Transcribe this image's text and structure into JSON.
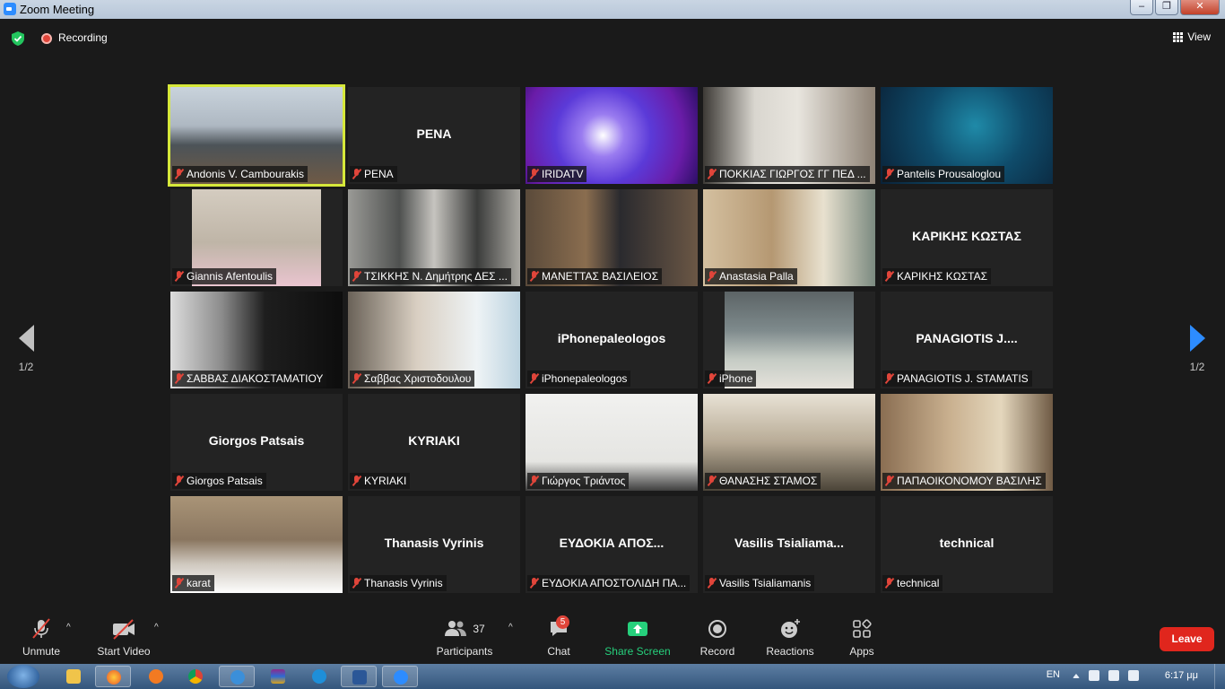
{
  "window": {
    "title": "Zoom Meeting",
    "min": "–",
    "max": "❐",
    "close": "✕"
  },
  "topbar": {
    "recording": "Recording",
    "view": "View"
  },
  "pager": {
    "left": "1/2",
    "right": "1/2"
  },
  "tiles": [
    {
      "label": "Andonis V. Cambourakis",
      "big": "",
      "video": "council-room",
      "active": true
    },
    {
      "label": "PENA",
      "big": "PENA",
      "video": ""
    },
    {
      "label": "IRIDATV",
      "big": "",
      "video": "iridatv-logo"
    },
    {
      "label": "ΠΟΚΚΙΑΣ ΓΙΩΡΓΟΣ ΓΓ ΠΕΔ ...",
      "big": "",
      "video": "office-man"
    },
    {
      "label": "Pantelis Prousaloglou",
      "big": "",
      "video": "knx-logo"
    },
    {
      "label": "Giannis Afentoulis",
      "big": "",
      "video": "man-white-hair"
    },
    {
      "label": "ΤΣΙΚΚΗΣ Ν. Δημήτρης ΔΕΣ ...",
      "big": "",
      "video": "bus-interior"
    },
    {
      "label": "ΜΑΝΕΤΤΑΣ ΒΑΣΙΛΕΙΟΣ",
      "big": "",
      "video": "bookshelf-man"
    },
    {
      "label": "Anastasia Palla",
      "big": "",
      "video": "room-painting"
    },
    {
      "label": "ΚΑΡΙΚΗΣ ΚΩΣΤΑΣ",
      "big": "ΚΑΡΙΚΗΣ ΚΩΣΤΑΣ",
      "video": ""
    },
    {
      "label": "ΣΑΒΒΑΣ ΔΙΑΚΟΣΤΑΜΑΤΙΟΥ",
      "big": "",
      "video": "dark-silhouette"
    },
    {
      "label": "Σαββας Χριστοδουλου",
      "big": "",
      "video": "close-face"
    },
    {
      "label": "iPhonepaleologos",
      "big": "iPhonepaleologos",
      "video": ""
    },
    {
      "label": "iPhone",
      "big": "",
      "video": "car-interior"
    },
    {
      "label": "PANAGIOTIS J. STAMATIS",
      "big": "PANAGIOTIS J....",
      "video": ""
    },
    {
      "label": "Giorgos Patsais",
      "big": "Giorgos Patsais",
      "video": ""
    },
    {
      "label": "KYRIAKI",
      "big": "KYRIAKI",
      "video": ""
    },
    {
      "label": "Γιώργος Τριάντος",
      "big": "",
      "video": "ceiling-light"
    },
    {
      "label": "ΘΑΝΑΣΗΣ ΣΤΑΜΟΣ",
      "big": "",
      "video": "office-old-man"
    },
    {
      "label": "ΠΑΠΑΟΙΚΟΝΟΜΟΥ ΒΑΣΙΛΗΣ",
      "big": "",
      "video": "living-room-man"
    },
    {
      "label": "karat",
      "big": "",
      "video": "man-glasses"
    },
    {
      "label": "Thanasis Vyrinis",
      "big": "Thanasis Vyrinis",
      "video": ""
    },
    {
      "label": "ΕΥΔΟΚΙΑ ΑΠΟΣΤΟΛΙΔΗ ΠΑ...",
      "big": "ΕΥΔΟΚΙΑ ΑΠΟΣ...",
      "video": ""
    },
    {
      "label": "Vasilis Tsialiamanis",
      "big": "Vasilis  Tsialiama...",
      "video": ""
    },
    {
      "label": "technical",
      "big": "technical",
      "video": ""
    }
  ],
  "toolbar": {
    "unmute": "Unmute",
    "start_video": "Start Video",
    "participants": "Participants",
    "participants_count": "37",
    "chat": "Chat",
    "chat_badge": "5",
    "share": "Share Screen",
    "record": "Record",
    "reactions": "Reactions",
    "apps": "Apps",
    "leave": "Leave"
  },
  "taskbar": {
    "lang": "EN",
    "clock": "6:17 μμ"
  },
  "colors": {
    "accent": "#2d8cff",
    "share_green": "#26d07c",
    "leave_red": "#e0261d",
    "active_border": "#d6e83a",
    "muted_red": "#e0453a"
  }
}
